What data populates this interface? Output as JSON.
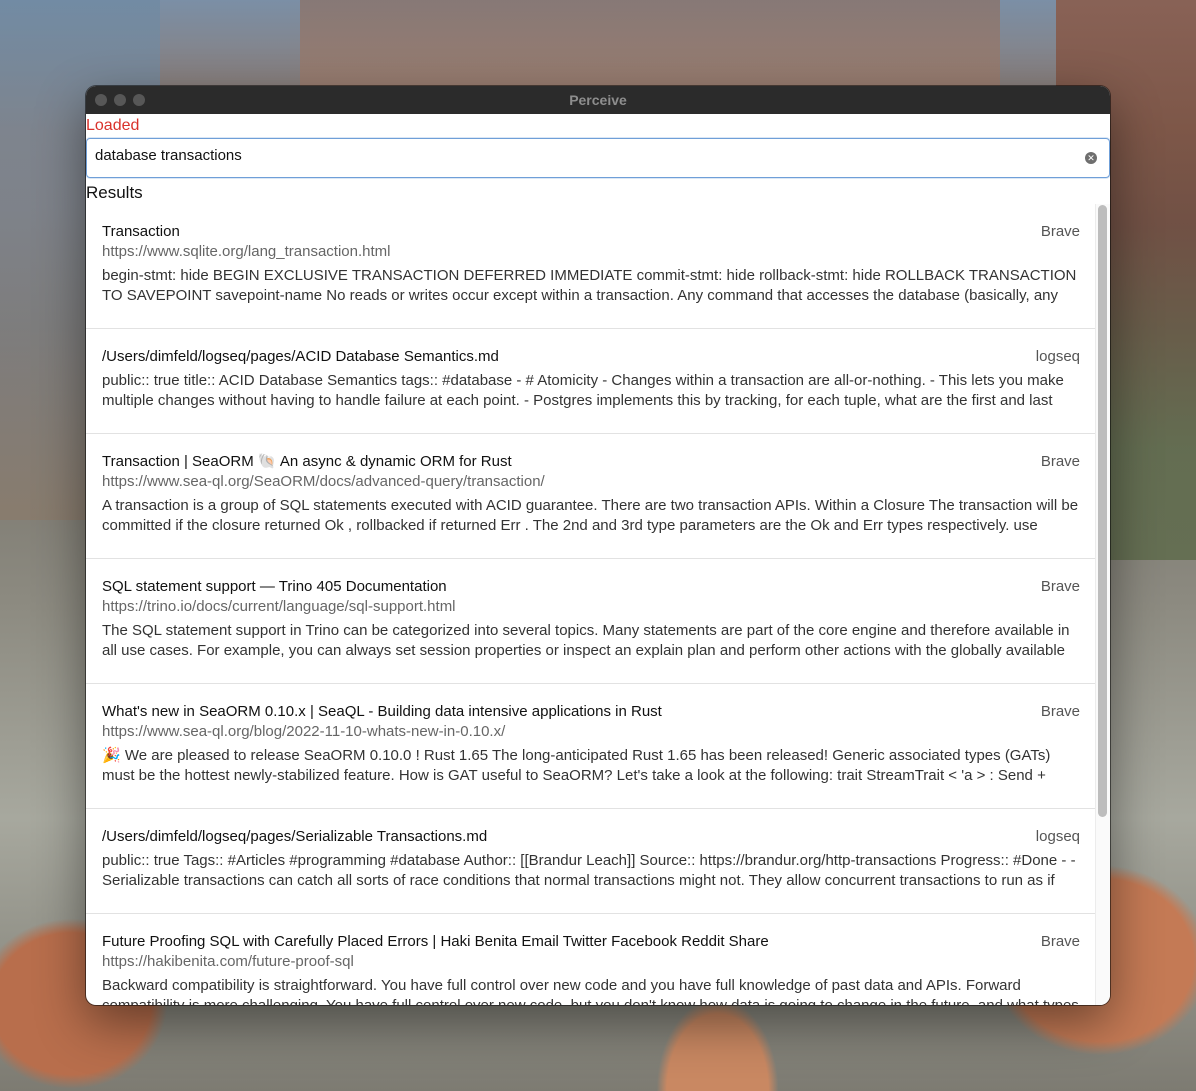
{
  "window": {
    "title": "Perceive"
  },
  "status": "Loaded",
  "search": {
    "value": "database transactions"
  },
  "results_heading": "Results",
  "results": [
    {
      "title": "Transaction",
      "source": "Brave",
      "url": "https://www.sqlite.org/lang_transaction.html",
      "snippet": "begin-stmt: hide BEGIN EXCLUSIVE TRANSACTION DEFERRED IMMEDIATE commit-stmt: hide rollback-stmt: hide ROLLBACK TRANSACTION TO SAVEPOINT savepoint-name No reads or writes occur except within a transaction. Any command that accesses the database (basically, any SQL"
    },
    {
      "title": "/Users/dimfeld/logseq/pages/ACID Database Semantics.md",
      "source": "logseq",
      "url": "",
      "snippet": "public:: true title:: ACID Database Semantics tags:: #database - # Atomicity - Changes within a transaction are all-or-nothing. - This lets you make multiple changes without having to handle failure at each point. - Postgres implements this by tracking, for each tuple, what are the first and last"
    },
    {
      "title": "Transaction | SeaORM 🐚 An async & dynamic ORM for Rust",
      "source": "Brave",
      "url": "https://www.sea-ql.org/SeaORM/docs/advanced-query/transaction/",
      "snippet": "A transaction is a group of SQL statements executed with ACID guarantee. There are two transaction APIs. Within a Closure  The transaction will be committed if the closure returned Ok , rollbacked if returned Err . The 2nd and 3rd type parameters are the Ok and Err types respectively. use sea_orm"
    },
    {
      "title": "SQL statement support — Trino 405 Documentation",
      "source": "Brave",
      "url": "https://trino.io/docs/current/language/sql-support.html",
      "snippet": "The SQL statement support in Trino can be categorized into several topics. Many statements are part of the core engine and therefore available in all use cases. For example, you can always set session properties or inspect an explain plan and perform other actions with the globally available"
    },
    {
      "title": "What's new in SeaORM 0.10.x | SeaQL - Building data intensive applications in Rust",
      "source": "Brave",
      "url": "https://www.sea-ql.org/blog/2022-11-10-whats-new-in-0.10.x/",
      "snippet": "🎉 We are pleased to release SeaORM 0.10.0 ! Rust 1.65  The long-anticipated Rust 1.65 has been released! Generic associated types (GATs) must be the hottest newly-stabilized feature. How is GAT useful to SeaORM? Let's take a look at the following: trait StreamTrait < 'a > : Send + Sync { type"
    },
    {
      "title": "/Users/dimfeld/logseq/pages/Serializable Transactions.md",
      "source": "logseq",
      "url": "",
      "snippet": "public:: true Tags:: #Articles #programming #database Author:: [[Brandur Leach]] Source:: https://brandur.org/http-transactions Progress:: #Done - - Serializable transactions can catch all sorts of race conditions that normal transactions might not. They allow concurrent transactions to run as if they"
    },
    {
      "title": "Future Proofing SQL with Carefully Placed Errors | Haki Benita Email Twitter Facebook Reddit Share",
      "source": "Brave",
      "url": "https://hakibenita.com/future-proof-sql",
      "snippet": "Backward compatibility is straightforward. You have full control over new code and you have full knowledge of past data and APIs. Forward compatibility is more challenging. You have full control over new code, but you don't know how data is going to change in the future, and what types of"
    }
  ]
}
